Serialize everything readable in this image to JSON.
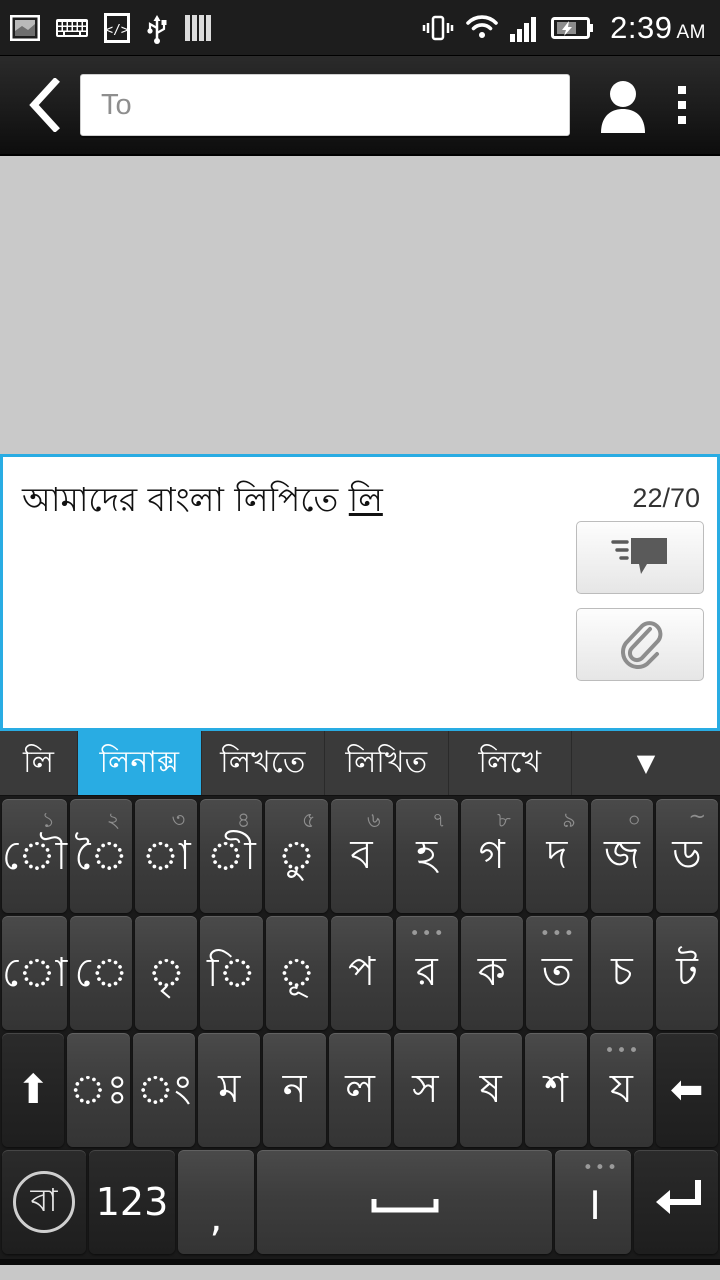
{
  "status_bar": {
    "icons": [
      "screenshot-icon",
      "keyboard-icon",
      "developer-mode-icon",
      "usb-icon",
      "bars-icon"
    ],
    "right_icons": [
      "vibrate-icon",
      "wifi-icon",
      "signal-icon",
      "battery-charging-icon"
    ],
    "time": "2:39",
    "meridiem": "AM"
  },
  "app_bar": {
    "back_label": "back",
    "recipient_placeholder": "To",
    "recipient_value": "",
    "contacts_label": "contacts",
    "overflow_label": "more options"
  },
  "compose": {
    "text_committed": "আমাদের বাংলা লিপিতে ",
    "text_composing": "লি",
    "counter": "22/70",
    "send_label": "send",
    "attach_label": "attach"
  },
  "suggestions": {
    "items": [
      {
        "label": "লি",
        "active": false
      },
      {
        "label": "লিনাক্স",
        "active": true
      },
      {
        "label": "লিখতে",
        "active": false
      },
      {
        "label": "লিখিত",
        "active": false
      },
      {
        "label": "লিখে",
        "active": false
      }
    ],
    "expand_label": "▼"
  },
  "keyboard": {
    "rows": [
      [
        {
          "label": "ৌ",
          "sup": "১",
          "vowel": true
        },
        {
          "label": "ৈ",
          "sup": "২",
          "vowel": true
        },
        {
          "label": "া",
          "sup": "৩",
          "vowel": true
        },
        {
          "label": "ী",
          "sup": "৪",
          "vowel": true
        },
        {
          "label": "ু",
          "sup": "৫",
          "vowel": true
        },
        {
          "label": "ব",
          "sup": "৬"
        },
        {
          "label": "হ",
          "sup": "৭"
        },
        {
          "label": "গ",
          "sup": "৮"
        },
        {
          "label": "দ",
          "sup": "৯"
        },
        {
          "label": "জ",
          "sup": "০"
        },
        {
          "label": "ড",
          "sup": "~"
        }
      ],
      [
        {
          "label": "ো",
          "vowel": true
        },
        {
          "label": "ে",
          "vowel": true
        },
        {
          "label": "ৃ",
          "vowel": true
        },
        {
          "label": "ি",
          "vowel": true
        },
        {
          "label": "ূ",
          "vowel": true
        },
        {
          "label": "প"
        },
        {
          "label": "র",
          "dots": "•••"
        },
        {
          "label": "ক"
        },
        {
          "label": "ত",
          "dots": "•••"
        },
        {
          "label": "চ"
        },
        {
          "label": "ট"
        }
      ],
      [
        {
          "label": "⬆",
          "name": "shift-key",
          "dark": true
        },
        {
          "label": "ঃ",
          "vowel": true
        },
        {
          "label": "ং",
          "vowel": true
        },
        {
          "label": "ম"
        },
        {
          "label": "ন"
        },
        {
          "label": "ল"
        },
        {
          "label": "স"
        },
        {
          "label": "ষ"
        },
        {
          "label": "শ"
        },
        {
          "label": "য",
          "dots": "•••"
        },
        {
          "label": "⬅",
          "name": "backspace-key",
          "dark": true
        }
      ]
    ],
    "bottom_row": {
      "language_key": "বা",
      "numeric_key": "123",
      "comma_key": ",",
      "space_key": "space",
      "danda_key": "।",
      "danda_dots": "•••",
      "enter_key": "enter"
    }
  },
  "colors": {
    "accent": "#29ace3",
    "statusbar_bg": "#1d1d1d",
    "keyboard_bg": "#1a1a1a",
    "thread_bg": "#c9c9c9"
  }
}
